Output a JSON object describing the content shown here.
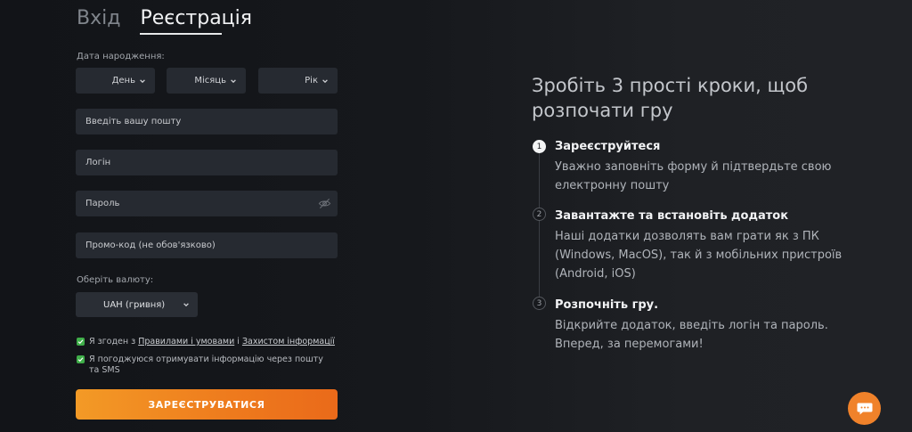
{
  "tabs": {
    "login": "Вхід",
    "register": "Реєстрація"
  },
  "form": {
    "birth_label": "Дата народження:",
    "day": "День",
    "month": "Місяць",
    "year": "Рік",
    "email_placeholder": "Введіть вашу пошту",
    "login_placeholder": "Логін",
    "password_placeholder": "Пароль",
    "promo_placeholder": "Промо-код (не обов'язково)",
    "currency_label": "Оберіть валюту:",
    "currency_value": "UAH (гривня)",
    "terms_prefix": "Я згоден з ",
    "terms_link": "Правилами і умовами",
    "terms_mid": " і ",
    "privacy_link": "Захистом інформації",
    "newsletter": "Я погоджуюся отримувати інформацію через пошту та SMS",
    "submit": "ЗАРЕЄСТРУВАТИСЯ"
  },
  "info": {
    "title": "Зробіть 3 прості кроки, щоб розпочати гру",
    "steps": [
      {
        "num": "1",
        "title": "Зареєструйтеся",
        "text": "Уважно заповніть форму й підтвердьте свою електронну пошту"
      },
      {
        "num": "2",
        "title": "Завантажте та встановіть додаток",
        "text": "Наші додатки дозволять вам грати як з ПК (Windows, MacOS), так й з мобільних пристроїв (Android, iOS)"
      },
      {
        "num": "3",
        "title": "Розпочніть гру.",
        "text": "Відкрийте додаток, введіть логін та пароль. Вперед, за перемогами!"
      }
    ]
  },
  "colors": {
    "accent": "#f0822a",
    "check": "#3fae49",
    "field_bg": "#262a31"
  },
  "icons": [
    "chevron-down-icon",
    "eye-off-icon",
    "checkmark-icon",
    "chat-icon"
  ]
}
